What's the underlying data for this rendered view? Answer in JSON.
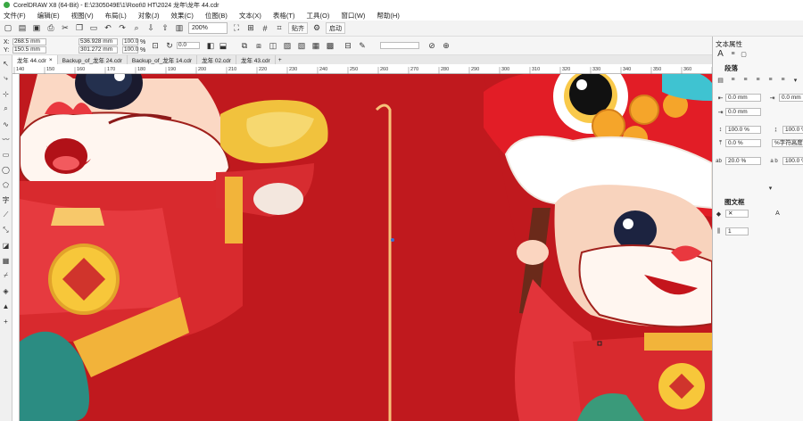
{
  "window": {
    "title": "CorelDRAW X8 (64-Bit) - E:\\2305049E\\1\\Root\\0 HT\\2024 龙年\\龙年 44.cdr"
  },
  "menu": [
    "文件(F)",
    "编辑(E)",
    "视图(V)",
    "布局(L)",
    "对象(J)",
    "效果(C)",
    "位图(B)",
    "文本(X)",
    "表格(T)",
    "工具(O)",
    "窗口(W)",
    "帮助(H)"
  ],
  "toolbar": {
    "zoom": "200%",
    "snap_label": "贴齐",
    "launch_label": "启动"
  },
  "propbar": {
    "x": "268.5 mm",
    "y": "150.5 mm",
    "width": "536.928 mm",
    "height": "301.272 mm",
    "scale_x": "100.0",
    "scale_y": "100.0",
    "pct": "%",
    "rotation": "0.0"
  },
  "tabs": [
    {
      "label": "龙年 44.cdr",
      "active": true
    },
    {
      "label": "Backup_of_龙年 24.cdr",
      "active": false
    },
    {
      "label": "Backup_of_龙年 14.cdr",
      "active": false
    },
    {
      "label": "龙年 02.cdr",
      "active": false
    },
    {
      "label": "龙年 43.cdr",
      "active": false
    }
  ],
  "ruler_ticks": [
    "140",
    "150",
    "160",
    "170",
    "180",
    "190",
    "200",
    "210",
    "220",
    "230",
    "240",
    "250",
    "260",
    "270",
    "280",
    "290",
    "300",
    "310",
    "320",
    "330",
    "340",
    "350",
    "360",
    "370"
  ],
  "panel": {
    "title": "文本属性",
    "paragraph_title": "段落",
    "indent_left": "0.0 mm",
    "indent_first": "0.0 mm",
    "indent_right": "0.0 mm",
    "spacing_para": "100.0 %",
    "spacing_line": "100.0 %",
    "spacing_before": "0.0 %",
    "spacing_unit": "%字符高度",
    "char_spacing": "20.0 %",
    "word_spacing": "100.0 %",
    "frame_title": "图文框",
    "columns": "1"
  },
  "colors": {
    "canvas": "#c0191e",
    "accent": "#3aa844"
  }
}
